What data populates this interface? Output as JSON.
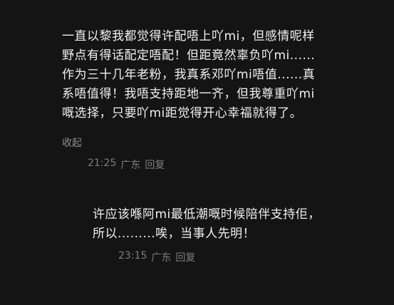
{
  "comments": [
    {
      "lines": [
        "一直以黎我都觉得许配唔上吖mi，但感情呢样",
        "野点有得话配定唔配！但距竟然辜负吖mi......",
        "作为三十几年老粉，我真系邓吖mi唔值......真",
        "系唔值得！我唔支持距地一齐，但我尊重吖mi",
        "嘅选择，只要吖mi距觉得开心幸福就得了。"
      ],
      "collapse_label": "收起",
      "time": "21:25",
      "location": "广东",
      "reply_label": "回复"
    },
    {
      "lines": [
        "许应该喺阿mi最低潮嘅时候陪伴支持佢，",
        "所以.........唉，当事人先明！"
      ],
      "time": "23:15",
      "location": "广东",
      "reply_label": "回复"
    }
  ]
}
